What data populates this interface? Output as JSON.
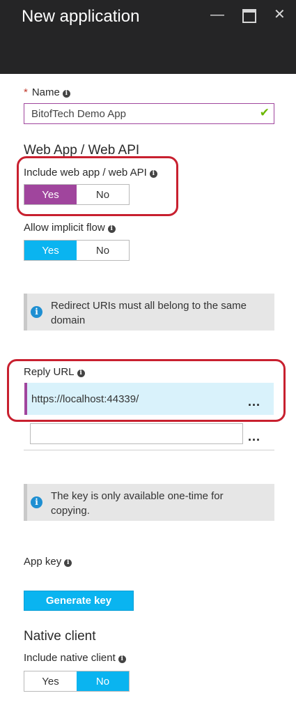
{
  "window": {
    "title": "New application",
    "minimize": "—",
    "close": "✕"
  },
  "name_field": {
    "label": "Name",
    "required_mark": "*",
    "value": "BitofTech Demo App",
    "valid_icon": "check-icon"
  },
  "webapp": {
    "heading": "Web App / Web API",
    "include_label": "Include web app / web API",
    "include_toggle": {
      "yes": "Yes",
      "no": "No",
      "selected": "Yes"
    },
    "implicit_label": "Allow implicit flow",
    "implicit_toggle": {
      "yes": "Yes",
      "no": "No",
      "selected": "Yes"
    }
  },
  "redirect_info": "Redirect URIs must all belong to the same domain",
  "reply_url": {
    "label": "Reply URL",
    "value": "https://localhost:44339/",
    "new_value": "",
    "more": "..."
  },
  "key_info": "The key is only available one-time for copying.",
  "app_key": {
    "label": "App key",
    "generate_button": "Generate key"
  },
  "native": {
    "heading": "Native client",
    "include_label": "Include native client",
    "toggle": {
      "yes": "Yes",
      "no": "No",
      "selected": "No"
    }
  },
  "colors": {
    "accent_purple": "#a0459d",
    "accent_blue": "#0ab4f0",
    "highlight_red": "#c8202f",
    "titlebar": "#252526"
  }
}
